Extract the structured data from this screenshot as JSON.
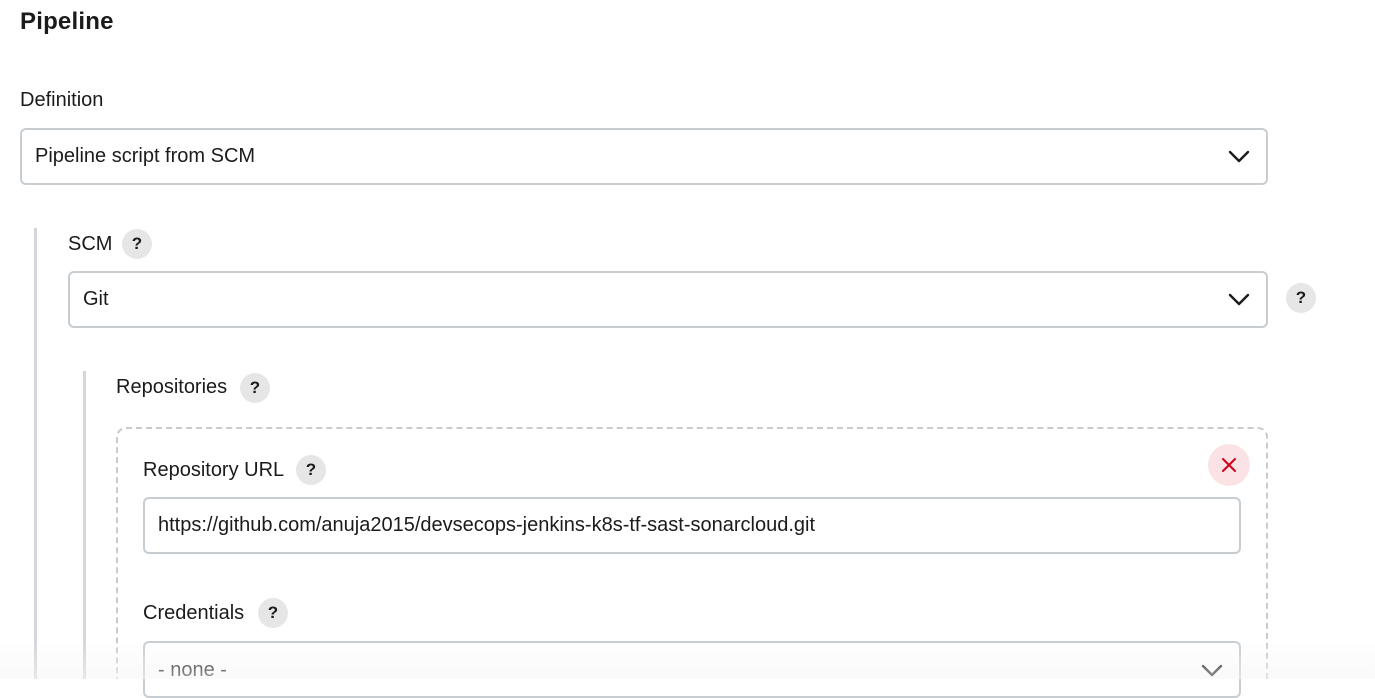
{
  "pipeline": {
    "title": "Pipeline",
    "definition_label": "Definition",
    "definition_value": "Pipeline script from SCM"
  },
  "scm": {
    "label": "SCM",
    "value": "Git",
    "help": "?"
  },
  "repositories": {
    "label": "Repositories",
    "help": "?",
    "repository_url_label": "Repository URL",
    "repository_url_help": "?",
    "repository_url_value": "https://github.com/anuja2015/devsecops-jenkins-k8s-tf-sast-sonarcloud.git",
    "credentials_label": "Credentials",
    "credentials_help": "?",
    "credentials_value": "- none -"
  },
  "icons": {
    "help": "question-mark",
    "dropdown": "chevron-down",
    "delete": "close-x"
  },
  "colors": {
    "delete_icon": "#d0021b",
    "delete_bg": "#fbe3e5",
    "help_bg": "#e6e6e6",
    "border": "#c7cdd1"
  }
}
